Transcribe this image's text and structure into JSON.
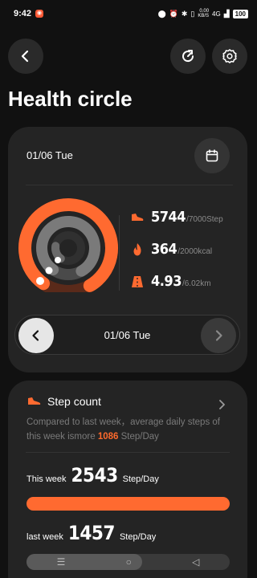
{
  "status_bar": {
    "time": "9:42",
    "speed_value": "0.00",
    "speed_unit": "KB/S",
    "network": "4G",
    "battery": "100"
  },
  "page": {
    "title": "Health circle"
  },
  "summary_card": {
    "date": "01/06 Tue",
    "stats": [
      {
        "icon": "shoe-icon",
        "value": "5744",
        "goal": "/7000Step"
      },
      {
        "icon": "flame-icon",
        "value": "364",
        "goal": "/2000kcal"
      },
      {
        "icon": "road-icon",
        "value": "4.93",
        "goal": "/6.02km"
      }
    ],
    "date_nav": {
      "label": "01/06 Tue"
    }
  },
  "step_card": {
    "title": "Step count",
    "desc_prefix": "Compared to last week，average daily steps of this week ismore ",
    "desc_value": "1086",
    "desc_suffix": " Step/Day",
    "this_week_label": "This week",
    "this_week_value": "2543",
    "this_week_unit": "Step/Day",
    "last_week_label": "last week",
    "last_week_value": "1457",
    "last_week_unit": "Step/Day"
  },
  "rings": {
    "steps_progress": 0.82,
    "calories_progress": 0.18,
    "distance_progress": 0.82
  },
  "colors": {
    "accent": "#ff6a30",
    "card": "#242424",
    "background": "#111111"
  }
}
